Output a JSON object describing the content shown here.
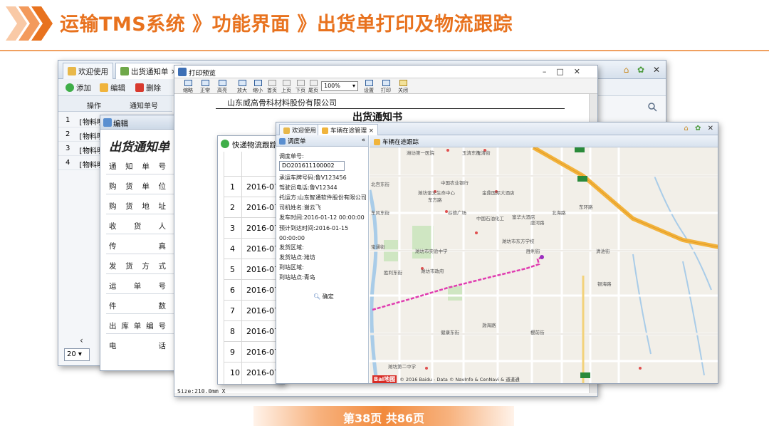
{
  "slide": {
    "title": "运输TMS系统 》功能界面 》出货单打印及物流跟踪",
    "footer": "第38页  共86页",
    "accent_color": "#e8721e"
  },
  "list_window": {
    "tabs": [
      {
        "label": "欢迎使用",
        "icon": "home-icon"
      },
      {
        "label": "出货通知单 ×",
        "icon": "document-icon"
      }
    ],
    "toolbar": {
      "add": "添加",
      "edit": "编辑",
      "delete": "删除"
    },
    "columns": [
      "操作",
      "通知单号"
    ],
    "rows": [
      {
        "n": "1",
        "v": "[物料明"
      },
      {
        "n": "2",
        "v": "[物料明"
      },
      {
        "n": "3",
        "v": "[物料明"
      },
      {
        "n": "4",
        "v": "[物料明"
      }
    ],
    "page_size": "20",
    "right_icons": [
      "home-icon",
      "gear-icon",
      "close-icon"
    ]
  },
  "edit_window": {
    "title": "编辑",
    "form_title": "出货通知单",
    "fields": [
      "通知单号",
      "购货单位",
      "购货地址",
      "收货人",
      "传真",
      "发货方式",
      "运单号",
      "件数",
      "出库单编号",
      "电话"
    ]
  },
  "print_window": {
    "title": "打印预览",
    "toolbar": [
      "缩略",
      "正常",
      "高亮",
      "放大",
      "缩小",
      "首页",
      "上页",
      "下页",
      "尾页",
      "设置",
      "打印",
      "关闭"
    ],
    "zoom": "100%",
    "company": "山东威高骨科材料股份有限公司",
    "doc_title": "出货通知书",
    "status": "Size:210.0mm X"
  },
  "express_window": {
    "title": "快递物流跟踪",
    "rows": [
      {
        "n": "1",
        "date": "2016-07-"
      },
      {
        "n": "2",
        "date": "2016-07-"
      },
      {
        "n": "3",
        "date": "2016-07-"
      },
      {
        "n": "4",
        "date": "2016-07-"
      },
      {
        "n": "5",
        "date": "2016-07-"
      },
      {
        "n": "6",
        "date": "2016-07-"
      },
      {
        "n": "7",
        "date": "2016-07-"
      },
      {
        "n": "8",
        "date": "2016-07-"
      },
      {
        "n": "9",
        "date": "2016-07-"
      },
      {
        "n": "10",
        "date": "2016-07-"
      }
    ]
  },
  "tracking_window": {
    "tabs": [
      {
        "label": "欢迎使用"
      },
      {
        "label": "车辆在途管理 ×"
      }
    ],
    "left_title": "调度单",
    "right_title": "车辆在途跟踪",
    "info": {
      "bill_label": "调度单号:",
      "bill_value": "DO201611100002",
      "vehicle": "承运车牌号码:鲁V123456",
      "driver_phone": "驾驶员电话:鲁V12344",
      "company": "托运方:山东智通软件股份有限公司",
      "driver": "司机姓名:谢云飞",
      "start_time": "发车时间:2016-01-12 00:00:00",
      "arrive_time": "预计到达时间:2016-01-15 00:00:00",
      "from_area": "发货区域:",
      "from_station": "发货站点:潍坊",
      "to_area": "到站区域:",
      "to_station": "到站站点:青岛",
      "ok": "确定"
    },
    "map": {
      "copyright": "© 2016 Baidu - Data © NavInfo & CenNavi & 道道通",
      "baidu": "Bai地图",
      "route_color": "#e03cb0",
      "labels": [
        "潍坊第一医院",
        "玉清东街",
        "北宫东街",
        "潍坊奎文生命中心",
        "中国农业银行",
        "金鼎国际大酒店",
        "潍坊市政府",
        "谷德广场",
        "中国石油化工",
        "富华大酒店",
        "东风东街",
        "潍坊市东方学校",
        "清池街",
        "宝通街",
        "健康东街",
        "胜利东街",
        "潍坊市实验中学",
        "东方路",
        "虞河路",
        "北海路",
        "东环路",
        "银海路",
        "玉清街",
        "胜利街",
        "樱前街",
        "潍坊第二中学",
        "渤海路"
      ]
    }
  }
}
